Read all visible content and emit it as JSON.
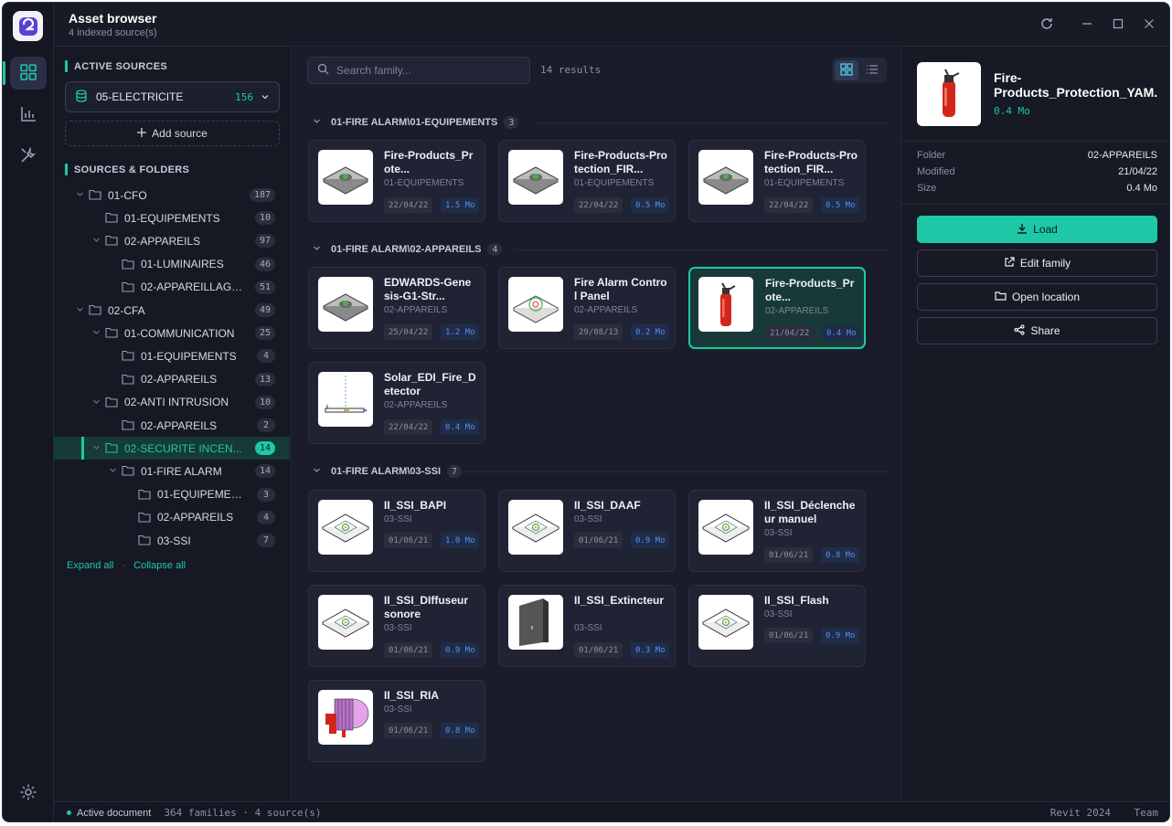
{
  "window": {
    "title": "Asset browser",
    "subtitle": "4 indexed source(s)"
  },
  "rail": {
    "items": [
      "grid-icon",
      "chart-icon",
      "tools-icon"
    ],
    "settings": "gear-icon"
  },
  "sidebar": {
    "active_sources_title": "ACTIVE SOURCES",
    "source": {
      "name": "05-ELECTRICITE",
      "count": "156"
    },
    "add_source_label": "Add source",
    "folders_title": "SOURCES & FOLDERS",
    "tree": [
      {
        "label": "01-CFO",
        "count": "187",
        "depth": 0,
        "chev": true
      },
      {
        "label": "01-EQUIPEMENTS",
        "count": "10",
        "depth": 1,
        "chev": false
      },
      {
        "label": "02-APPAREILS",
        "count": "97",
        "depth": 1,
        "chev": true
      },
      {
        "label": "01-LUMINAIRES",
        "count": "46",
        "depth": 2,
        "chev": false
      },
      {
        "label": "02-APPAREILLAGES",
        "count": "51",
        "depth": 2,
        "chev": false
      },
      {
        "label": "02-CFA",
        "count": "49",
        "depth": 0,
        "chev": true
      },
      {
        "label": "01-COMMUNICATION",
        "count": "25",
        "depth": 1,
        "chev": true
      },
      {
        "label": "01-EQUIPEMENTS",
        "count": "4",
        "depth": 2,
        "chev": false
      },
      {
        "label": "02-APPAREILS",
        "count": "13",
        "depth": 2,
        "chev": false
      },
      {
        "label": "02-ANTI INTRUSION",
        "count": "10",
        "depth": 1,
        "chev": true
      },
      {
        "label": "02-APPAREILS",
        "count": "2",
        "depth": 2,
        "chev": false
      },
      {
        "label": "02-SECURITE INCEN...",
        "count": "14",
        "depth": 1,
        "chev": true,
        "selected": true
      },
      {
        "label": "01-FIRE ALARM",
        "count": "14",
        "depth": 2,
        "chev": true
      },
      {
        "label": "01-EQUIPEMEN...",
        "count": "3",
        "depth": 3,
        "chev": false
      },
      {
        "label": "02-APPAREILS",
        "count": "4",
        "depth": 3,
        "chev": false
      },
      {
        "label": "03-SSI",
        "count": "7",
        "depth": 3,
        "chev": false
      }
    ],
    "expand_all": "Expand all",
    "separator": "·",
    "collapse_all": "Collapse all"
  },
  "main": {
    "search_placeholder": "Search family...",
    "results": "14 results",
    "groups": [
      {
        "title": "01-FIRE ALARM\\01-EQUIPEMENTS",
        "count": "3"
      },
      {
        "title": "01-FIRE ALARM\\02-APPAREILS",
        "count": "4"
      },
      {
        "title": "01-FIRE ALARM\\03-SSI",
        "count": "7"
      }
    ],
    "cards": [
      {
        "name": "Fire-Products_Prote...",
        "folder": "01-EQUIPEMENTS",
        "date": "22/04/22",
        "size": "1.5 Mo",
        "thumb": "device-plate-icon"
      },
      {
        "name": "Fire-Products-Protection_FIR...",
        "folder": "01-EQUIPEMENTS",
        "date": "22/04/22",
        "size": "0.5 Mo",
        "thumb": "device-plate-icon"
      },
      {
        "name": "Fire-Products-Protection_FIR...",
        "folder": "01-EQUIPEMENTS",
        "date": "22/04/22",
        "size": "0.5 Mo",
        "thumb": "device-plate-icon"
      },
      {
        "name": "EDWARDS-Genesis-G1-Str...",
        "folder": "02-APPAREILS",
        "date": "25/04/22",
        "size": "1.2 Mo",
        "thumb": "device-plate-icon"
      },
      {
        "name": "Fire Alarm Control Panel",
        "folder": "02-APPAREILS",
        "date": "29/08/13",
        "size": "0.2 Mo",
        "thumb": "panel-icon"
      },
      {
        "name": "Fire-Products_Prote...",
        "folder": "02-APPAREILS",
        "date": "21/04/22",
        "size": "0.4 Mo",
        "thumb": "extinguisher-icon",
        "selected": true
      },
      {
        "name": "Solar_EDI_Fire_Detector",
        "folder": "02-APPAREILS",
        "date": "22/04/22",
        "size": "0.4 Mo",
        "thumb": "detector-icon"
      },
      {
        "name": "II_SSI_BAPI",
        "folder": "03-SSI",
        "date": "01/06/21",
        "size": "1.0 Mo",
        "thumb": "ssi-plate-icon"
      },
      {
        "name": "II_SSI_DAAF",
        "folder": "03-SSI",
        "date": "01/06/21",
        "size": "0.9 Mo",
        "thumb": "ssi-plate-icon"
      },
      {
        "name": "II_SSI_Déclencheur manuel",
        "folder": "03-SSI",
        "date": "01/06/21",
        "size": "0.8 Mo",
        "thumb": "ssi-plate-icon"
      },
      {
        "name": "II_SSI_DIffuseur sonore",
        "folder": "03-SSI",
        "date": "01/06/21",
        "size": "0.9 Mo",
        "thumb": "ssi-plate-icon"
      },
      {
        "name": "II_SSI_Extincteur",
        "folder": "03-SSI",
        "date": "01/06/21",
        "size": "0.3 Mo",
        "thumb": "box-icon"
      },
      {
        "name": "II_SSI_Flash",
        "folder": "03-SSI",
        "date": "01/06/21",
        "size": "0.9 Mo",
        "thumb": "ssi-plate-icon"
      },
      {
        "name": "II_SSI_RIA",
        "folder": "03-SSI",
        "date": "01/06/21",
        "size": "0.8 Mo",
        "thumb": "hose-reel-icon"
      }
    ]
  },
  "detail": {
    "name": "Fire-Products_Protection_YAM...",
    "size": "0.4 Mo",
    "props": [
      {
        "key": "Folder",
        "value": "02-APPAREILS"
      },
      {
        "key": "Modified",
        "value": "21/04/22"
      },
      {
        "key": "Size",
        "value": "0.4 Mo"
      }
    ],
    "load_label": "Load",
    "edit_label": "Edit family",
    "open_label": "Open location",
    "share_label": "Share"
  },
  "status": {
    "doc_label": "Active document",
    "summary": "364 families · 4 source(s)",
    "version": "Revit 2024",
    "team": "Team"
  },
  "colors": {
    "accent": "#1ec8a6",
    "background": "#181a26",
    "size_badge": "#5a8fe8"
  }
}
